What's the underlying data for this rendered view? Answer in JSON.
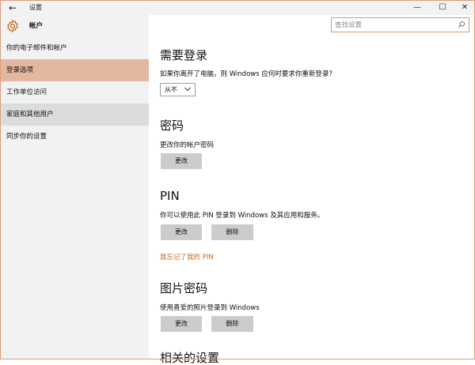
{
  "window": {
    "title": "设置",
    "back_glyph": "←",
    "min_glyph": "—",
    "max_glyph": "☐",
    "close_glyph": "✕"
  },
  "search": {
    "placeholder": "查找设置",
    "value": "",
    "icon": "search-icon"
  },
  "sidebar": {
    "header_label": "帐户",
    "header_icon": "gear-icon",
    "items": [
      {
        "label": "你的电子邮件和帐户",
        "selected": false
      },
      {
        "label": "登录选项",
        "selected": true
      },
      {
        "label": "工作单位访问",
        "selected": false
      },
      {
        "label": "家庭和其他用户",
        "selected": false
      },
      {
        "label": "同步你的设置",
        "selected": false
      }
    ]
  },
  "main": {
    "signin_required": {
      "title": "需要登录",
      "description": "如果你离开了电脑，则 Windows 应何时要求你重新登录？",
      "dropdown_value": "从不"
    },
    "password": {
      "title": "密码",
      "description": "更改你的帐户密码",
      "change_label": "更改"
    },
    "pin": {
      "title": "PIN",
      "description": "你可以使用此 PIN 登录到 Windows 及其应用和服务。",
      "change_label": "更改",
      "remove_label": "删除",
      "forgot_link": "我忘记了我的 PIN"
    },
    "picture_password": {
      "title": "图片密码",
      "description": "使用喜爱的照片登录到 Windows",
      "change_label": "更改",
      "remove_label": "删除"
    },
    "related_settings": {
      "title": "相关的设置"
    }
  },
  "colors": {
    "accent": "#c86a17",
    "selected_nav": "#e3b7a0",
    "sidebar_bg": "#f2f2f2",
    "button_bg": "#cccccc",
    "border_accent": "#d9a07a"
  }
}
